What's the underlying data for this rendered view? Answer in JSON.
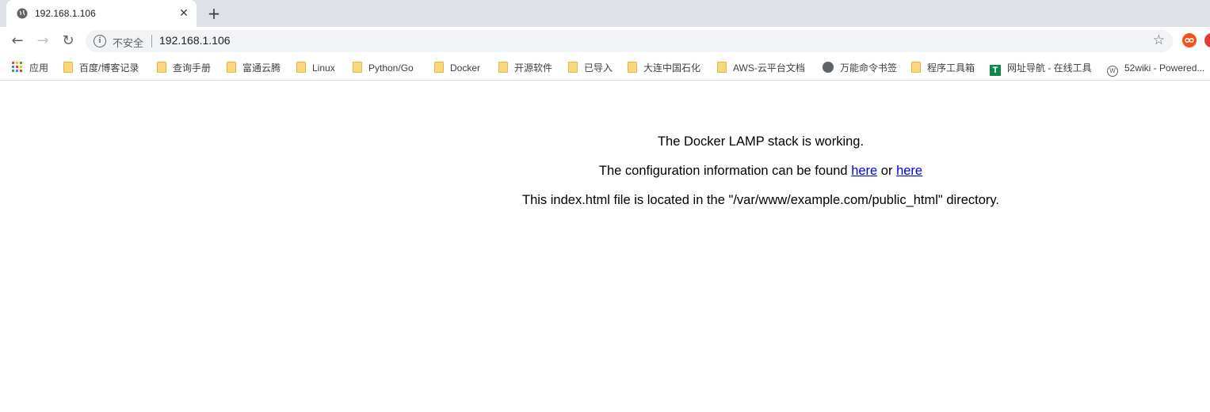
{
  "tab": {
    "title": "192.168.1.106",
    "close": "✕"
  },
  "newtab": "+",
  "nav": {
    "back": "←",
    "forward": "→",
    "reload": "↻"
  },
  "omnibox": {
    "info": "i",
    "security_label": "不安全",
    "url": "192.168.1.106",
    "star": "☆"
  },
  "bookmarks": [
    {
      "label": "应用",
      "icon": "apps-icon"
    },
    {
      "label": "百度/博客记录",
      "icon": "folder-icon"
    },
    {
      "label": "查询手册",
      "icon": "folder-icon"
    },
    {
      "label": "富通云腾",
      "icon": "folder-icon"
    },
    {
      "label": "Linux",
      "icon": "folder-icon"
    },
    {
      "label": "Python/Go",
      "icon": "folder-icon"
    },
    {
      "label": "Docker",
      "icon": "folder-icon"
    },
    {
      "label": "开源软件",
      "icon": "folder-icon"
    },
    {
      "label": "已导入",
      "icon": "folder-icon"
    },
    {
      "label": "大连中国石化",
      "icon": "folder-icon"
    },
    {
      "label": "AWS-云平台文档",
      "icon": "folder-icon"
    },
    {
      "label": "万能命令书签",
      "icon": "globe-icon"
    },
    {
      "label": "程序工具箱",
      "icon": "folder-icon"
    },
    {
      "label": "网址导航 - 在线工具",
      "icon": "t-icon",
      "icon_text": "T"
    },
    {
      "label": "52wiki - Powered...",
      "icon": "w-icon",
      "icon_text": "W"
    }
  ],
  "page": {
    "line1": "The Docker LAMP stack is working.",
    "line2_prefix": "The configuration information can be found ",
    "link1": "here",
    "line2_mid": " or ",
    "link2": "here",
    "line3": "This index.html file is located in the \"/var/www/example.com/public_html\" directory."
  },
  "colors": {
    "link": "#0000ee",
    "tabstrip": "#dee1e6",
    "omnibox": "#f1f3f4",
    "folder": "#f9d77d"
  }
}
